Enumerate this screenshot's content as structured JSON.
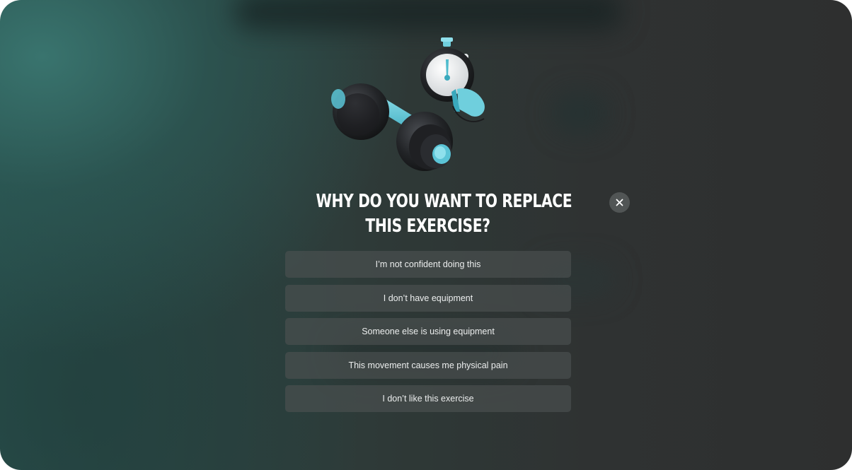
{
  "dialog": {
    "title_line1": "WHY DO YOU WANT TO REPLACE",
    "title_line2": "THIS EXERCISE?",
    "close_icon": "close-icon",
    "options": [
      {
        "label": "I’m not confident doing this"
      },
      {
        "label": "I don’t have equipment"
      },
      {
        "label": "Someone else is using equipment"
      },
      {
        "label": "This movement causes me physical pain"
      },
      {
        "label": "I don’t like this exercise"
      }
    ]
  },
  "illustration": {
    "icons": [
      "dumbbell-icon",
      "stopwatch-icon",
      "whistle-icon"
    ]
  },
  "colors": {
    "accent": "#5bc4d6",
    "background_teal": "#3a7670",
    "background_dark": "#2e2f2f"
  }
}
